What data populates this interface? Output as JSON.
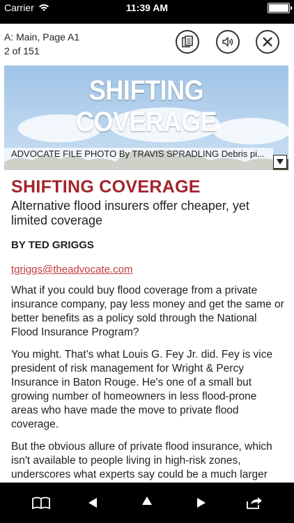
{
  "status_bar": {
    "carrier": "Carrier",
    "time": "11:39 AM",
    "battery_level": 1.0
  },
  "header": {
    "section_page": "A: Main, Page A1",
    "page_count": "2 of 151",
    "buttons": [
      {
        "name": "pages-icon"
      },
      {
        "name": "speaker-icon"
      },
      {
        "name": "close-icon"
      }
    ]
  },
  "photo": {
    "headline": "SHIFTING COVERAGE",
    "caption": "ADVOCATE FILE PHOTO By TRAVIS SPRADLING Debris pi..."
  },
  "article": {
    "title": "SHIFTING COVERAGE",
    "subtitle": "Alternative flood insurers offer cheaper, yet limited coverage",
    "byline": "BY TED GRIGGS",
    "email": "tgriggs@theadvocate.com",
    "paragraphs": [
      "What if you could buy flood coverage from a private insurance company, pay less money and get the same or better benefits as a policy sold through the National Flood Insurance Program?",
      "You might. That's what Louis G. Fey Jr. did. Fey is vice president of risk management for Wright & Percy Insurance in Baton Rouge. He's one of a small but growing number of homeowners in less flood-prone areas who have made the move to private flood coverage.",
      "But the obvious allure of private flood insurance, which isn't available to people living in high-risk zones, underscores what experts say could be a much larger downside. Private insurers cherry-picking"
    ]
  },
  "toolbar": {
    "buttons": [
      "book-icon",
      "previous-icon",
      "up-icon",
      "next-icon",
      "share-icon"
    ]
  }
}
